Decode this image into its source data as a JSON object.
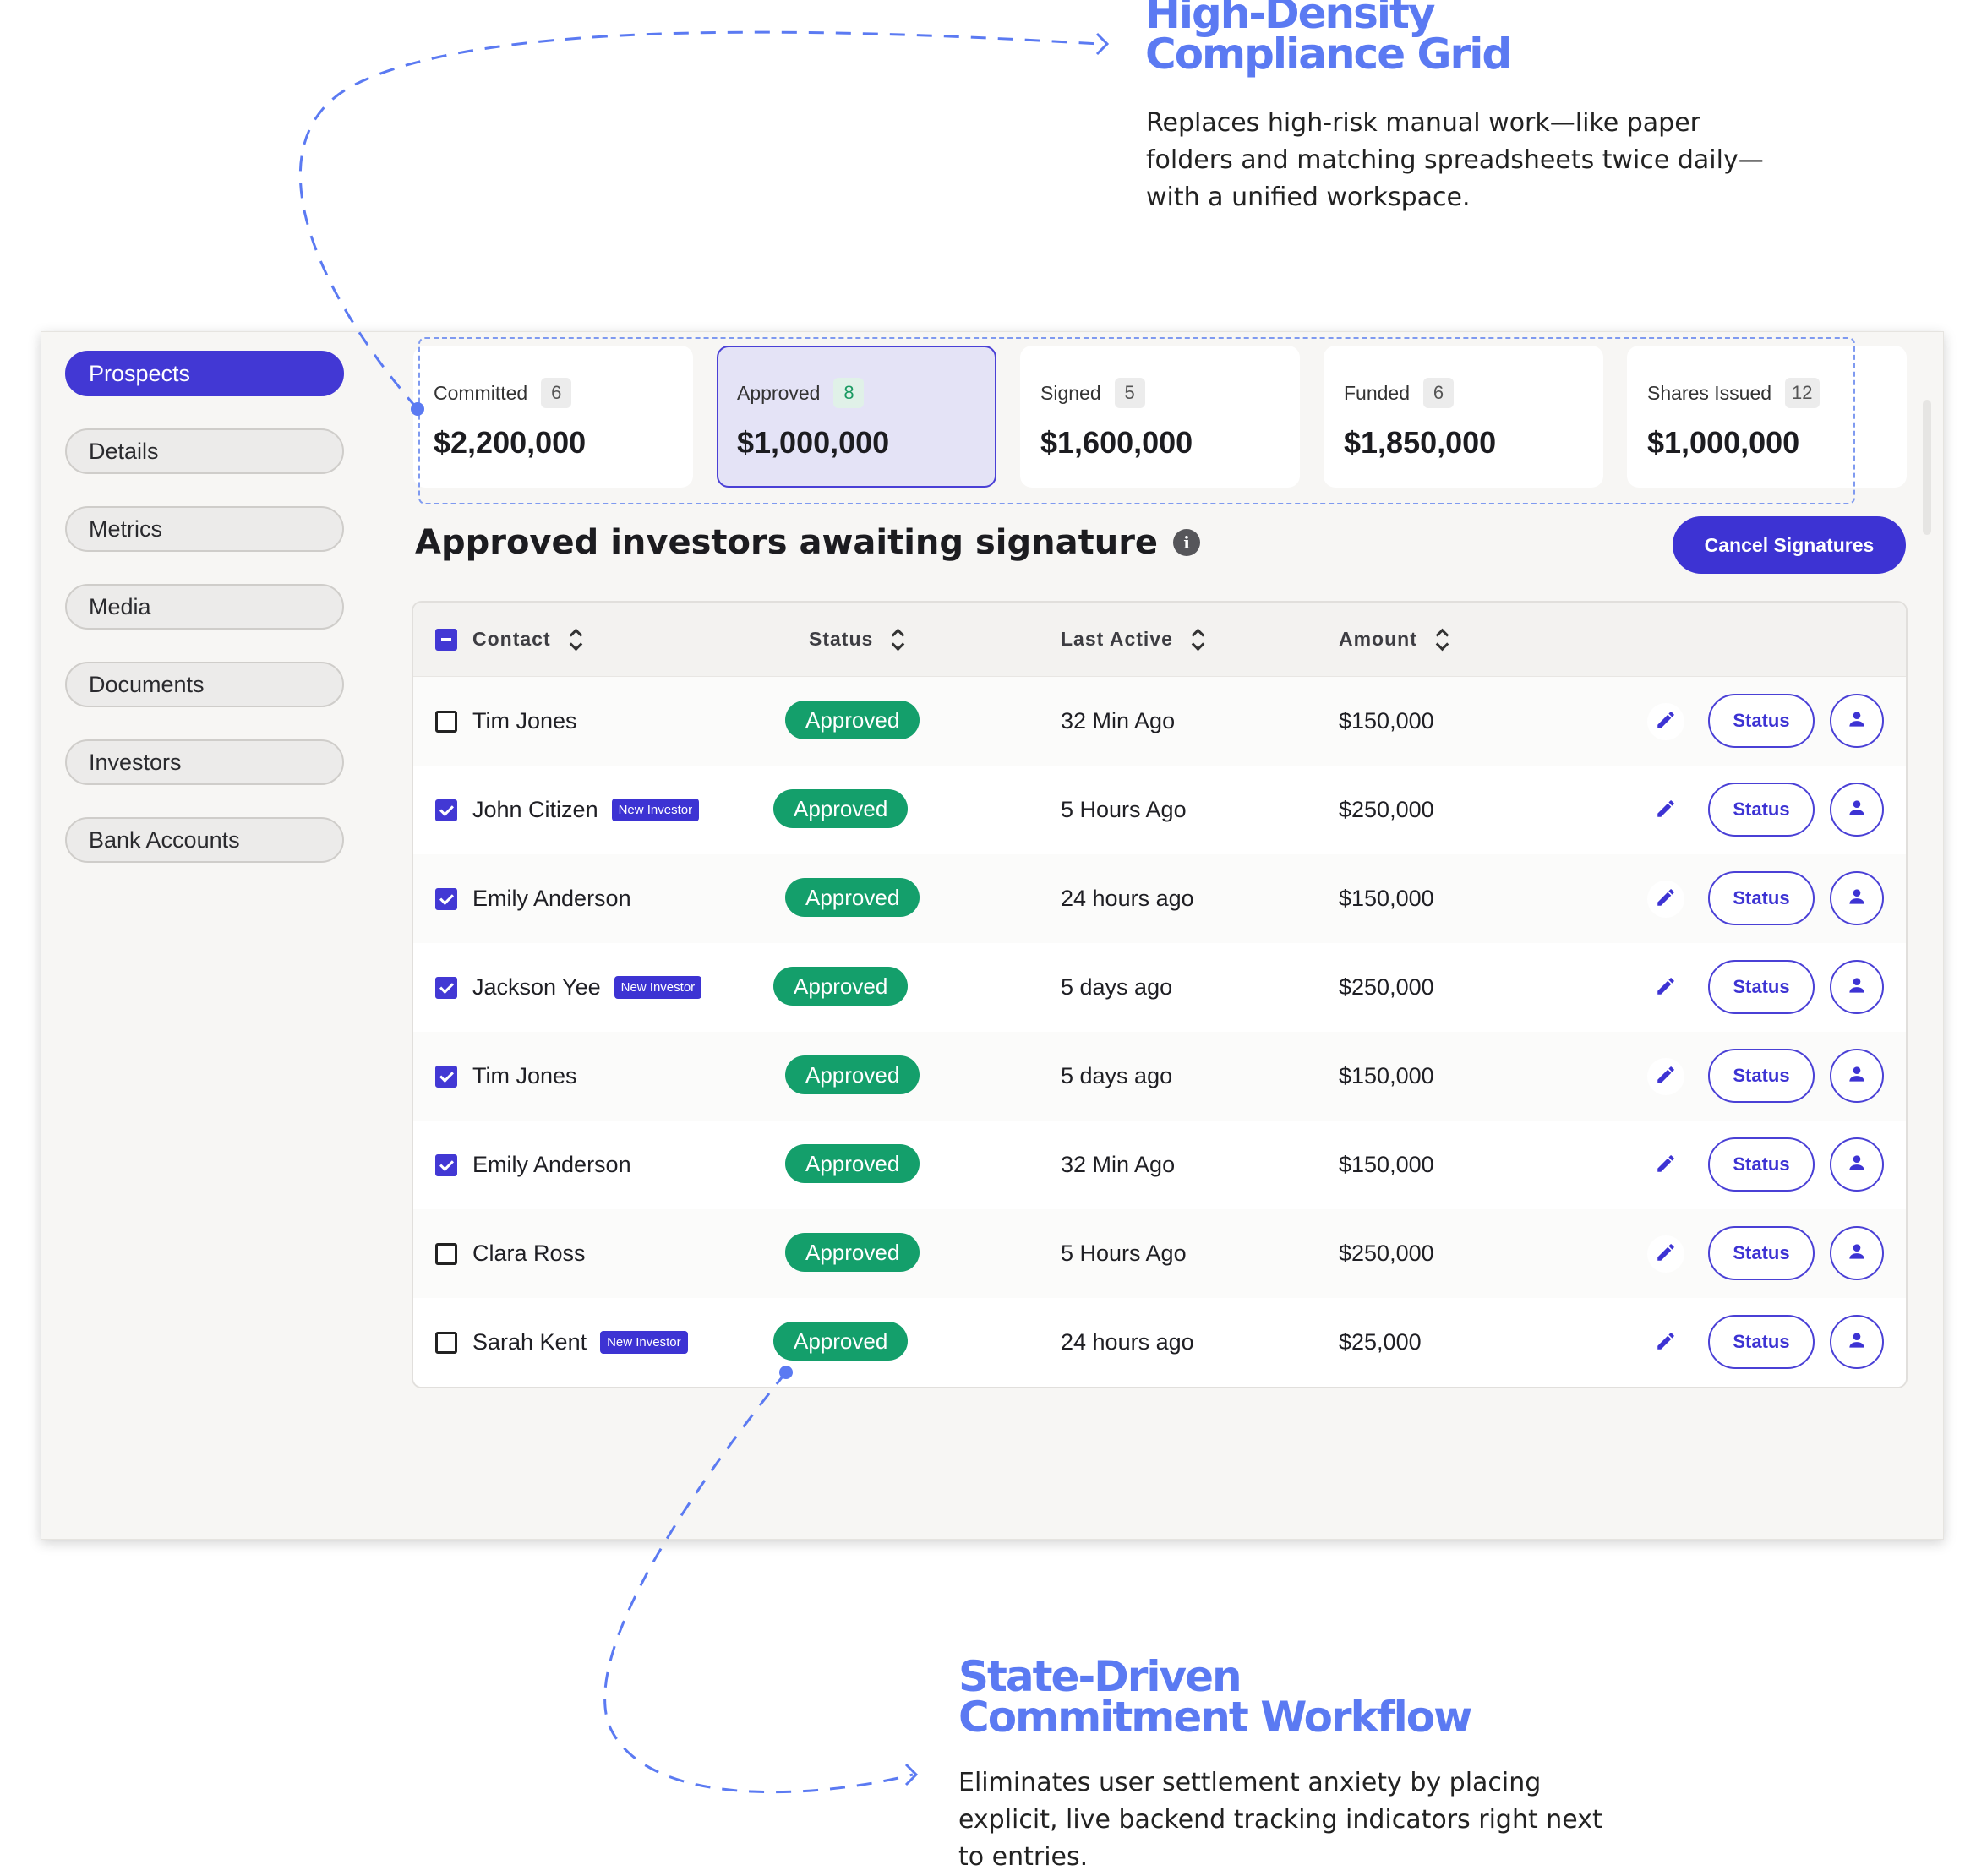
{
  "callouts": {
    "top": {
      "title_line1": "High-Density",
      "title_line2": "Compliance Grid",
      "desc_line1": "Replaces high-risk manual work—like paper",
      "desc_line2": "folders and matching spreadsheets twice daily—",
      "desc_line3": "with a unified workspace."
    },
    "bottom": {
      "title_line1": "State-Driven",
      "title_line2": "Commitment Workflow",
      "desc_line1": "Eliminates user settlement anxiety by placing",
      "desc_line2": "explicit, live backend tracking indicators right next",
      "desc_line3": "to entries."
    },
    "accent_color": "#5b7af2"
  },
  "sidebar": {
    "items": [
      {
        "label": "Prospects",
        "active": true
      },
      {
        "label": "Details"
      },
      {
        "label": "Metrics"
      },
      {
        "label": "Media"
      },
      {
        "label": "Documents"
      },
      {
        "label": "Investors"
      },
      {
        "label": "Bank Accounts"
      }
    ]
  },
  "stats": [
    {
      "label": "Committed",
      "count": "6",
      "amount": "$2,200,000"
    },
    {
      "label": "Approved",
      "count": "8",
      "amount": "$1,000,000",
      "active": true
    },
    {
      "label": "Signed",
      "count": "5",
      "amount": "$1,600,000"
    },
    {
      "label": "Funded",
      "count": "6",
      "amount": "$1,850,000"
    },
    {
      "label": "Shares Issued",
      "count": "12",
      "amount": "$1,000,000"
    }
  ],
  "section": {
    "title": "Approved investors awaiting signature",
    "info_icon": "info-icon",
    "cancel_label": "Cancel Signatures"
  },
  "table": {
    "headers": {
      "contact": "Contact",
      "status": "Status",
      "last_active": "Last Active",
      "amount": "Amount"
    },
    "row_action_label": "Status",
    "new_badge_label": "New Investor",
    "rows": [
      {
        "name": "Tim Jones",
        "checked": false,
        "new": false,
        "status": "Approved",
        "last_active": "32 Min Ago",
        "amount": "$150,000"
      },
      {
        "name": "John Citizen",
        "checked": true,
        "new": true,
        "status": "Approved",
        "last_active": "5 Hours Ago",
        "amount": "$250,000"
      },
      {
        "name": "Emily Anderson",
        "checked": true,
        "new": false,
        "status": "Approved",
        "last_active": "24 hours ago",
        "amount": "$150,000"
      },
      {
        "name": "Jackson Yee",
        "checked": true,
        "new": true,
        "status": "Approved",
        "last_active": "5 days ago",
        "amount": "$250,000"
      },
      {
        "name": "Tim Jones",
        "checked": true,
        "new": false,
        "status": "Approved",
        "last_active": "5 days ago",
        "amount": "$150,000"
      },
      {
        "name": "Emily Anderson",
        "checked": true,
        "new": false,
        "status": "Approved",
        "last_active": "32 Min Ago",
        "amount": "$150,000"
      },
      {
        "name": "Clara Ross",
        "checked": false,
        "new": false,
        "status": "Approved",
        "last_active": "5 Hours Ago",
        "amount": "$250,000"
      },
      {
        "name": "Sarah Kent",
        "checked": false,
        "new": true,
        "status": "Approved",
        "last_active": "24 hours ago",
        "amount": "$25,000"
      }
    ]
  },
  "colors": {
    "primary": "#3d33d3",
    "approved_green": "#149f6b"
  }
}
